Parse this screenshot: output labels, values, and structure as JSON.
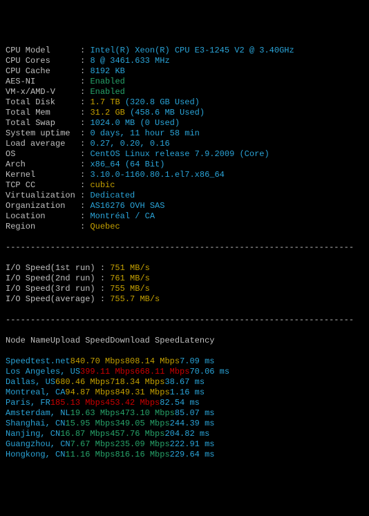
{
  "sys": [
    {
      "label": "CPU Model",
      "parts": [
        {
          "c": "cyan",
          "t": "Intel(R) Xeon(R) CPU E3-1245 V2 @ 3.40GHz"
        }
      ]
    },
    {
      "label": "CPU Cores",
      "parts": [
        {
          "c": "cyan",
          "t": "8 @ 3461.633 MHz"
        }
      ]
    },
    {
      "label": "CPU Cache",
      "parts": [
        {
          "c": "cyan",
          "t": "8192 KB"
        }
      ]
    },
    {
      "label": "AES-NI",
      "parts": [
        {
          "c": "green",
          "t": "Enabled"
        }
      ]
    },
    {
      "label": "VM-x/AMD-V",
      "parts": [
        {
          "c": "green",
          "t": "Enabled"
        }
      ]
    },
    {
      "label": "Total Disk",
      "parts": [
        {
          "c": "yellow",
          "t": "1.7 TB "
        },
        {
          "c": "cyan",
          "t": "(320.8 GB Used)"
        }
      ]
    },
    {
      "label": "Total Mem",
      "parts": [
        {
          "c": "yellow",
          "t": "31.2 GB "
        },
        {
          "c": "cyan",
          "t": "(458.6 MB Used)"
        }
      ]
    },
    {
      "label": "Total Swap",
      "parts": [
        {
          "c": "cyan",
          "t": "1024.0 MB (0 Used)"
        }
      ]
    },
    {
      "label": "System uptime",
      "parts": [
        {
          "c": "cyan",
          "t": "0 days, 11 hour 58 min"
        }
      ]
    },
    {
      "label": "Load average",
      "parts": [
        {
          "c": "cyan",
          "t": "0.27, 0.20, 0.16"
        }
      ]
    },
    {
      "label": "OS",
      "parts": [
        {
          "c": "cyan",
          "t": "CentOS Linux release 7.9.2009 (Core)"
        }
      ]
    },
    {
      "label": "Arch",
      "parts": [
        {
          "c": "cyan",
          "t": "x86_64 (64 Bit)"
        }
      ]
    },
    {
      "label": "Kernel",
      "parts": [
        {
          "c": "cyan",
          "t": "3.10.0-1160.80.1.el7.x86_64"
        }
      ]
    },
    {
      "label": "TCP CC",
      "parts": [
        {
          "c": "yellow",
          "t": "cubic"
        }
      ]
    },
    {
      "label": "Virtualization",
      "parts": [
        {
          "c": "cyan",
          "t": "Dedicated"
        }
      ]
    },
    {
      "label": "Organization",
      "parts": [
        {
          "c": "cyan",
          "t": "AS16276 OVH SAS"
        }
      ]
    },
    {
      "label": "Location",
      "parts": [
        {
          "c": "cyan",
          "t": "Montréal / CA"
        }
      ]
    },
    {
      "label": "Region",
      "parts": [
        {
          "c": "yellow",
          "t": "Quebec"
        }
      ]
    }
  ],
  "io": [
    {
      "label": "I/O Speed(1st run) ",
      "val": "751 MB/s"
    },
    {
      "label": "I/O Speed(2nd run) ",
      "val": "761 MB/s"
    },
    {
      "label": "I/O Speed(3rd run) ",
      "val": "755 MB/s"
    },
    {
      "label": "I/O Speed(average) ",
      "val": "755.7 MB/s"
    }
  ],
  "speed_header": {
    "node": "Node Name",
    "up": "Upload Speed",
    "dn": "Download Speed",
    "lat": "Latency"
  },
  "speed_rows": [
    {
      "c": "yellow",
      "node": "Speedtest.net",
      "up": "840.70 Mbps",
      "dn": "808.14 Mbps",
      "lat": "7.09 ms"
    },
    {
      "c": "red",
      "node": "Los Angeles, US",
      "up": "399.11 Mbps",
      "dn": "668.11 Mbps",
      "lat": "70.06 ms"
    },
    {
      "c": "yellow",
      "node": "Dallas, US",
      "up": "680.46 Mbps",
      "dn": "718.34 Mbps",
      "lat": "38.67 ms"
    },
    {
      "c": "yellow",
      "node": "Montreal, CA",
      "up": "94.87 Mbps",
      "dn": "849.31 Mbps",
      "lat": "1.16 ms"
    },
    {
      "c": "red",
      "node": "Paris, FR",
      "up": "185.13 Mbps",
      "dn": "453.42 Mbps",
      "lat": "82.54 ms"
    },
    {
      "c": "green",
      "node": "Amsterdam, NL",
      "up": "19.63 Mbps",
      "dn": "473.10 Mbps",
      "lat": "85.07 ms"
    },
    {
      "c": "green",
      "node": "Shanghai, CN",
      "up": "15.95 Mbps",
      "dn": "349.05 Mbps",
      "lat": "244.39 ms"
    },
    {
      "c": "green",
      "node": "Nanjing, CN",
      "up": "16.87 Mbps",
      "dn": "457.76 Mbps",
      "lat": "204.82 ms"
    },
    {
      "c": "green",
      "node": "Guangzhou, CN",
      "up": "7.67 Mbps",
      "dn": "235.09 Mbps",
      "lat": "222.91 ms"
    },
    {
      "c": "green",
      "node": "Hongkong, CN",
      "up": "11.16 Mbps",
      "dn": "816.16 Mbps",
      "lat": "229.64 ms"
    }
  ],
  "divider": "----------------------------------------------------------------------"
}
